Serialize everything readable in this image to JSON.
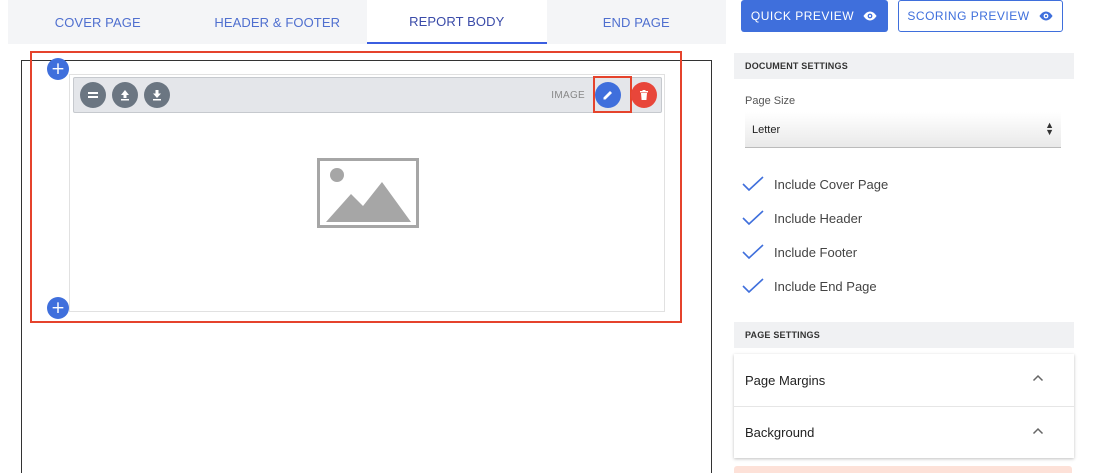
{
  "tabs": [
    {
      "label": "COVER PAGE"
    },
    {
      "label": "HEADER & FOOTER"
    },
    {
      "label": "REPORT BODY"
    },
    {
      "label": "END PAGE"
    }
  ],
  "active_tab": "REPORT BODY",
  "block": {
    "type_label": "IMAGE",
    "toolbar_icons": [
      "drag-handle-icon",
      "move-up-icon",
      "move-down-icon",
      "edit-icon",
      "delete-icon"
    ],
    "placeholder_icon": "image-placeholder-icon"
  },
  "add_icon": "plus-icon",
  "preview": {
    "quick_label": "QUICK PREVIEW",
    "scoring_label": "SCORING PREVIEW",
    "icon": "eye-icon"
  },
  "document_settings": {
    "heading": "DOCUMENT SETTINGS",
    "page_size_label": "Page Size",
    "page_size_value": "Letter",
    "checks": [
      {
        "label": "Include Cover Page",
        "checked": true
      },
      {
        "label": "Include Header",
        "checked": true
      },
      {
        "label": "Include Footer",
        "checked": true
      },
      {
        "label": "Include End Page",
        "checked": true
      }
    ]
  },
  "page_settings": {
    "heading": "PAGE SETTINGS",
    "items": [
      {
        "label": "Page Margins"
      },
      {
        "label": "Background"
      }
    ]
  },
  "colors": {
    "accent": "#3f6fdc",
    "delete": "#e8463a",
    "highlight": "#e5432c",
    "tool_gray": "#6b7682"
  }
}
